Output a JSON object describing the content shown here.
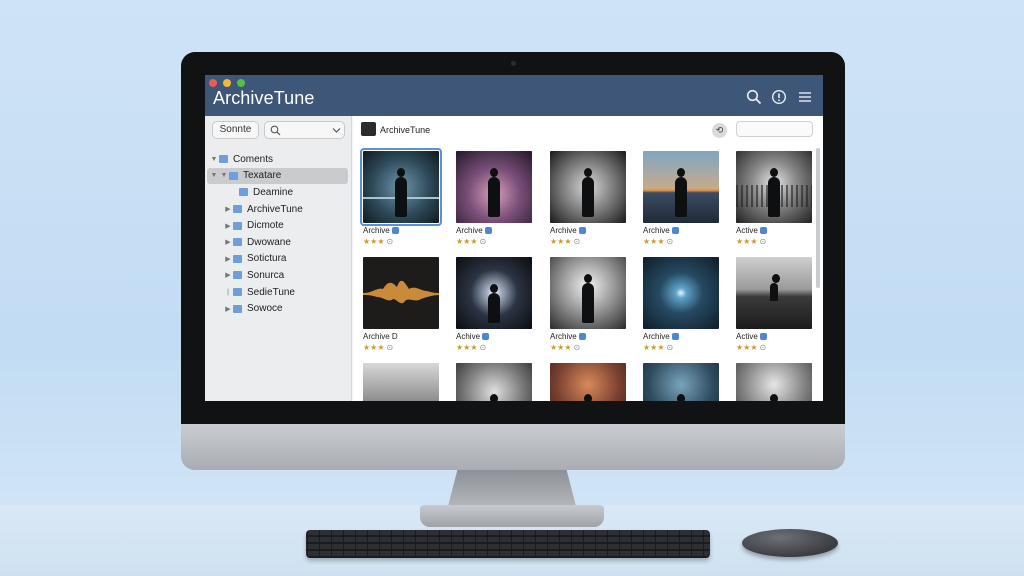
{
  "app": {
    "title": "ArchiveTune"
  },
  "colors": {
    "titlebar": "#3e5779",
    "selection_outline": "#5b8fd6",
    "star": "#c99a2e"
  },
  "titlebar_icons": [
    "search-icon",
    "info-icon",
    "menu-icon"
  ],
  "sidebar": {
    "filter_label": "Sonnte",
    "search_icon": "search-icon",
    "chevron_icon": "chevron-down-icon",
    "items": [
      {
        "label": "Coments",
        "expanded": true
      },
      {
        "label": "Texatare",
        "selected": true,
        "expanded": true
      },
      {
        "label": "Deamine"
      },
      {
        "label": "ArchiveTune"
      },
      {
        "label": "Dicmote"
      },
      {
        "label": "Dwowane"
      },
      {
        "label": "Sotictura"
      },
      {
        "label": "Sonurca"
      },
      {
        "label": "SedieTune"
      },
      {
        "label": "Sowoce"
      }
    ]
  },
  "content": {
    "header_title": "ArchiveTune",
    "tiles": [
      {
        "label": "Archive",
        "stars": "★★★",
        "info": "⊙",
        "badge": true,
        "selected": true
      },
      {
        "label": "Archive",
        "stars": "★★★",
        "info": "⊙",
        "badge": true
      },
      {
        "label": "Archive",
        "stars": "★★★",
        "info": "⊙",
        "badge": true
      },
      {
        "label": "Archive",
        "stars": "★★★",
        "info": "⊙",
        "badge": true
      },
      {
        "label": "Active",
        "stars": "★★★",
        "info": "⊙",
        "badge": true
      },
      {
        "label": "Archive D",
        "stars": "★★★",
        "info": "⊙",
        "badge": false
      },
      {
        "label": "Achive",
        "stars": "★★★",
        "info": "⊙",
        "badge": true
      },
      {
        "label": "Archive",
        "stars": "★★★",
        "info": "⊙",
        "badge": true
      },
      {
        "label": "Archive",
        "stars": "★★★",
        "info": "⊙",
        "badge": true
      },
      {
        "label": "Active",
        "stars": "★★★",
        "info": "⊙",
        "badge": true
      },
      {
        "label": "",
        "stars": "",
        "info": "",
        "badge": false
      },
      {
        "label": "",
        "stars": "",
        "info": "",
        "badge": false
      },
      {
        "label": "",
        "stars": "",
        "info": "",
        "badge": false
      },
      {
        "label": "",
        "stars": "",
        "info": "",
        "badge": false
      },
      {
        "label": "",
        "stars": "",
        "info": "",
        "badge": false
      }
    ]
  }
}
